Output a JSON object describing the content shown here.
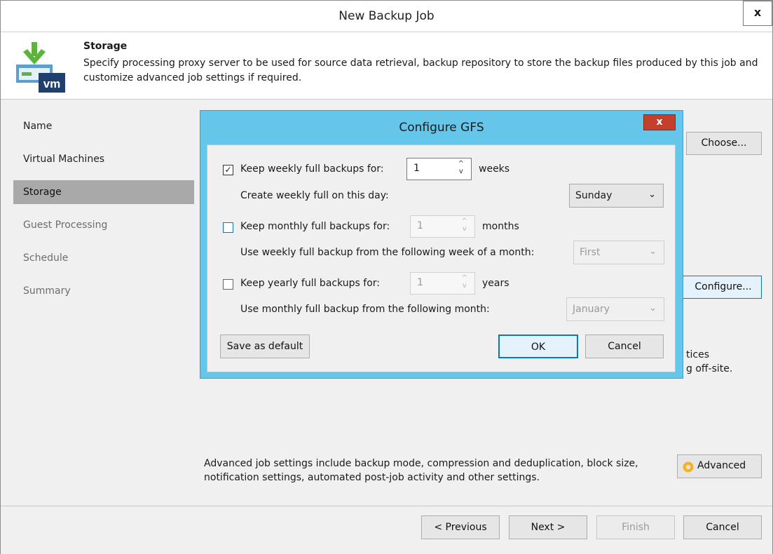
{
  "window": {
    "title": "New Backup Job",
    "close_label": "x"
  },
  "header": {
    "title": "Storage",
    "description": "Specify processing proxy server to be used for source data retrieval, backup repository to store the backup files produced by this job and customize advanced job settings if required.",
    "icon": "vm-download-icon"
  },
  "sidebar": {
    "items": [
      {
        "label": "Name",
        "state": "normal"
      },
      {
        "label": "Virtual Machines",
        "state": "normal"
      },
      {
        "label": "Storage",
        "state": "active"
      },
      {
        "label": "Guest Processing",
        "state": "disabled"
      },
      {
        "label": "Schedule",
        "state": "disabled"
      },
      {
        "label": "Summary",
        "state": "disabled"
      }
    ]
  },
  "main": {
    "choose_label": "Choose...",
    "configure_label": "Configure...",
    "partial_text_1": "tices",
    "partial_text_2": "g off-site.",
    "advanced_desc": "Advanced job settings include backup mode, compression and deduplication, block size, notification settings, automated post-job activity and other settings.",
    "advanced_label": "Advanced"
  },
  "footer": {
    "previous_label": "< Previous",
    "next_label": "Next >",
    "finish_label": "Finish",
    "cancel_label": "Cancel"
  },
  "dialog": {
    "title": "Configure GFS",
    "close_label": "x",
    "weekly": {
      "checked": true,
      "label": "Keep weekly full backups for:",
      "value": "1",
      "unit": "weeks",
      "day_label": "Create weekly full on this day:",
      "day_value": "Sunday"
    },
    "monthly": {
      "checked": false,
      "label": "Keep monthly full backups for:",
      "value": "1",
      "unit": "months",
      "week_label": "Use weekly full backup from the following week of a month:",
      "week_value": "First"
    },
    "yearly": {
      "checked": false,
      "label": "Keep yearly full backups for:",
      "value": "1",
      "unit": "years",
      "month_label": "Use monthly full backup from the following month:",
      "month_value": "January"
    },
    "save_default_label": "Save as default",
    "ok_label": "OK",
    "cancel_label": "Cancel"
  },
  "colors": {
    "dialog_frame": "#66c6ea",
    "close_button": "#c2402c",
    "active_nav": "#a9a9a9",
    "focus_border": "#0078d7",
    "icon_green": "#5bb53b"
  }
}
